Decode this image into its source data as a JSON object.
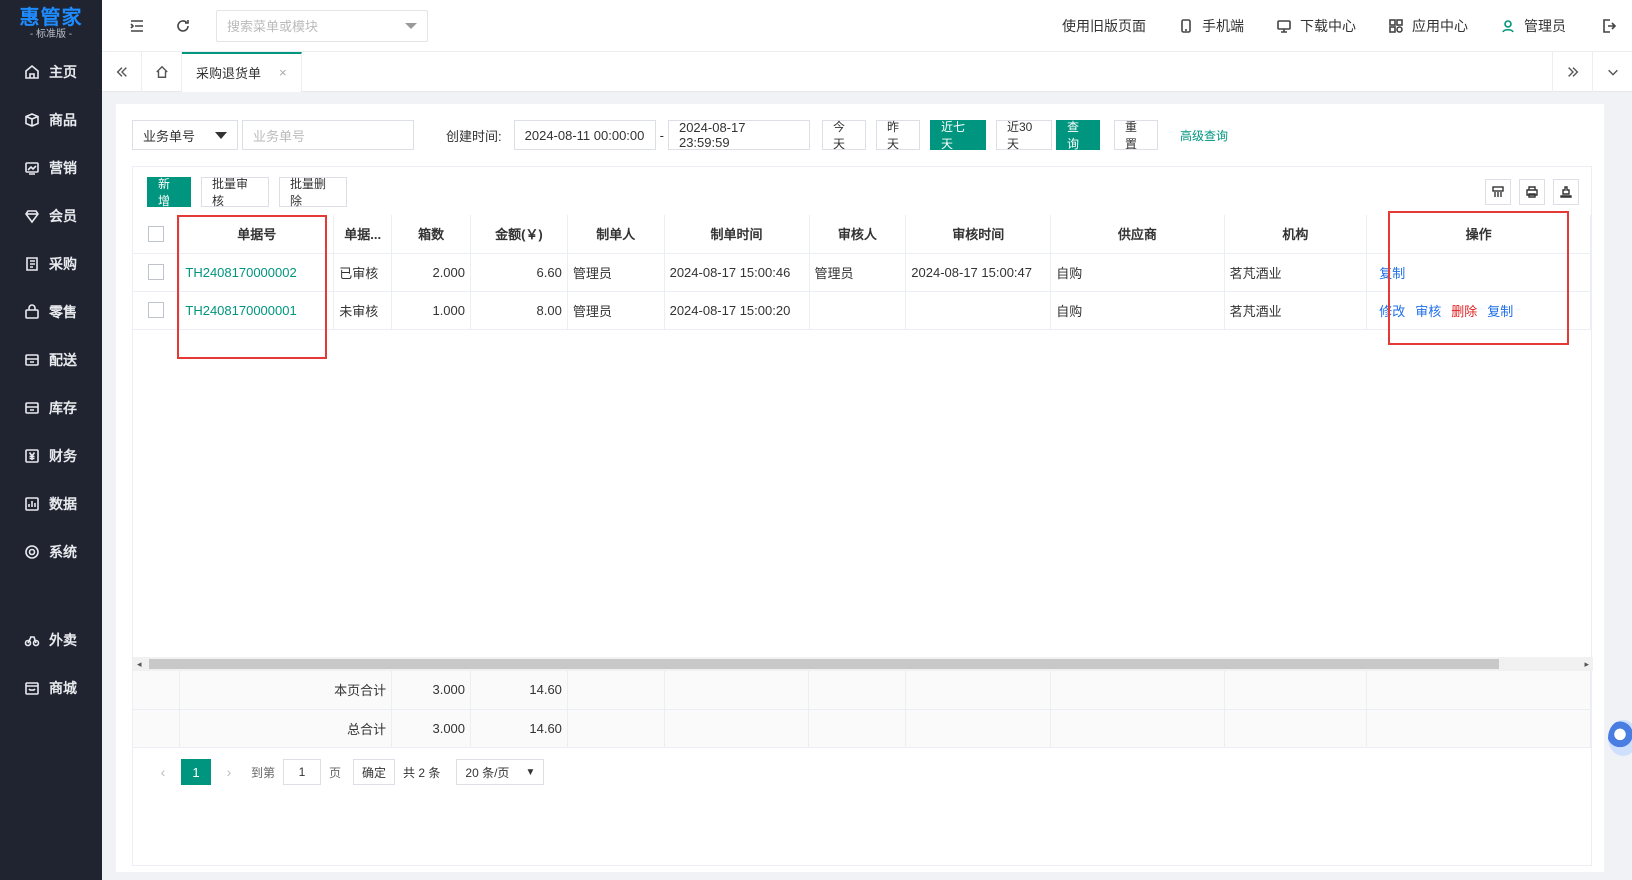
{
  "app": {
    "brand": "惠管家",
    "edition": "- 标准版 -"
  },
  "sidebar": {
    "items": [
      {
        "label": "主页",
        "icon": "home-icon"
      },
      {
        "label": "商品",
        "icon": "box-icon"
      },
      {
        "label": "营销",
        "icon": "chart-icon"
      },
      {
        "label": "会员",
        "icon": "diamond-icon"
      },
      {
        "label": "采购",
        "icon": "purchase-icon"
      },
      {
        "label": "零售",
        "icon": "bag-icon"
      },
      {
        "label": "配送",
        "icon": "truck-icon"
      },
      {
        "label": "库存",
        "icon": "warehouse-icon"
      },
      {
        "label": "财务",
        "icon": "yen-icon"
      },
      {
        "label": "数据",
        "icon": "bar-chart-icon"
      },
      {
        "label": "系统",
        "icon": "settings-icon"
      },
      {
        "label": "外卖",
        "icon": "bike-icon"
      },
      {
        "label": "商城",
        "icon": "store-icon"
      }
    ]
  },
  "header": {
    "search_placeholder": "搜索菜单或模块",
    "links": [
      "使用旧版页面",
      "手机端",
      "下载中心",
      "应用中心",
      "管理员"
    ]
  },
  "tabs": {
    "active": "采购退货单",
    "close": "×"
  },
  "filter": {
    "field_select": "业务单号",
    "field_placeholder": "业务单号",
    "created_label": "创建时间:",
    "date_from": "2024-08-11 00:00:00",
    "date_sep": "-",
    "date_to": "2024-08-17 23:59:59",
    "quick": [
      "今天",
      "昨天",
      "近七天",
      "近30天"
    ],
    "active_quick": "近七天",
    "query": "查询",
    "reset": "重置",
    "advanced": "高级查询"
  },
  "toolbar": {
    "add": "新增",
    "batch_audit": "批量审核",
    "batch_delete": "批量删除"
  },
  "table": {
    "columns": [
      "单据号",
      "单据...",
      "箱数",
      "金额(￥)",
      "制单人",
      "制单时间",
      "审核人",
      "审核时间",
      "供应商",
      "机构",
      "操作"
    ],
    "rows": [
      {
        "doc_no": "TH2408170000002",
        "status": "已审核",
        "boxes": "2.000",
        "amount": "6.60",
        "maker": "管理员",
        "made_at": "2024-08-17 15:00:46",
        "auditor": "管理员",
        "audited_at": "2024-08-17 15:00:47",
        "supplier": "自购",
        "org": "茗芃酒业",
        "ops": [
          "复制"
        ]
      },
      {
        "doc_no": "TH2408170000001",
        "status": "未审核",
        "boxes": "1.000",
        "amount": "8.00",
        "maker": "管理员",
        "made_at": "2024-08-17 15:00:20",
        "auditor": "",
        "audited_at": "",
        "supplier": "自购",
        "org": "茗芃酒业",
        "ops": [
          "修改",
          "审核",
          "删除",
          "复制"
        ]
      }
    ],
    "footer": [
      {
        "label": "本页合计",
        "boxes": "3.000",
        "amount": "14.60"
      },
      {
        "label": "总合计",
        "boxes": "3.000",
        "amount": "14.60"
      }
    ]
  },
  "pager": {
    "current": "1",
    "goto_label": "到第",
    "goto_value": "1",
    "page_unit": "页",
    "confirm": "确定",
    "total": "共 2 条",
    "page_size": "20 条/页"
  }
}
